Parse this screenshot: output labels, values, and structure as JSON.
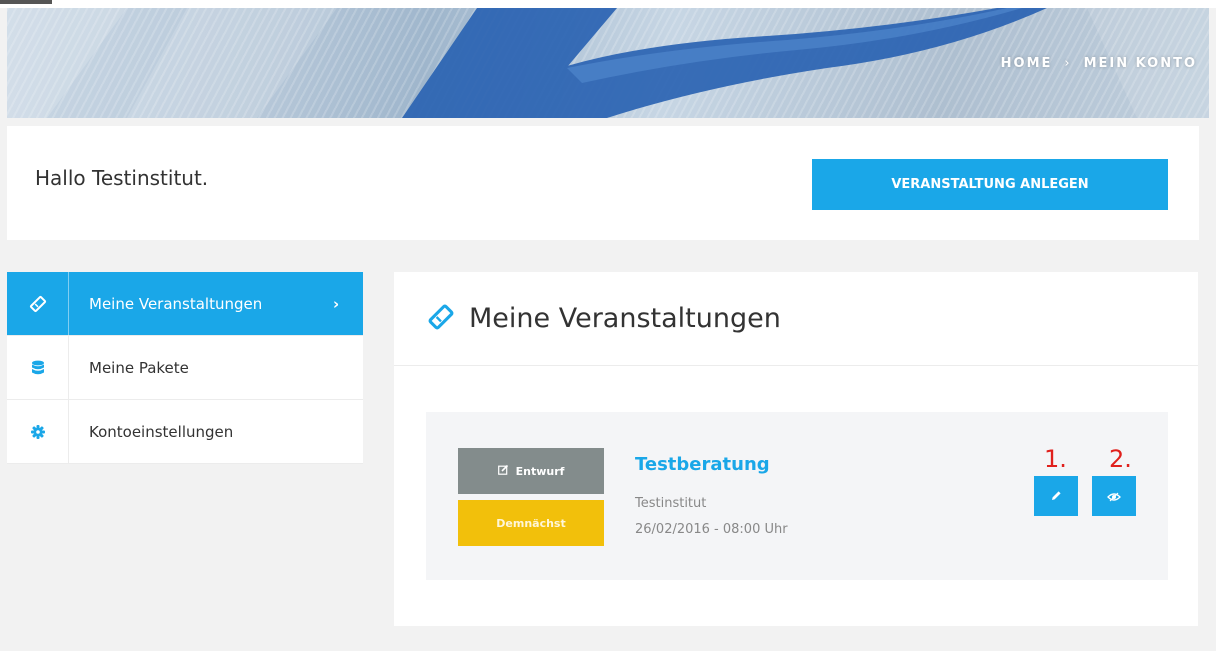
{
  "header": {
    "breadcrumb": {
      "home": "HOME",
      "separator": "›",
      "current": "MEIN KONTO"
    }
  },
  "greeting": {
    "text": "Hallo Testinstitut."
  },
  "actions": {
    "create_event_label": "VERANSTALTUNG ANLEGEN"
  },
  "sidebar": {
    "items": [
      {
        "label": "Meine Veranstaltungen",
        "icon": "ticket-icon",
        "active": true
      },
      {
        "label": "Meine Pakete",
        "icon": "database-icon",
        "active": false
      },
      {
        "label": "Kontoeinstellungen",
        "icon": "gear-icon",
        "active": false
      }
    ]
  },
  "main": {
    "title": "Meine Veranstaltungen",
    "events": [
      {
        "status_label": "Entwurf",
        "schedule_label": "Demnächst",
        "title": "Testberatung",
        "organizer": "Testinstitut",
        "datetime": "26/02/2016 - 08:00 Uhr",
        "action_numbers": [
          "1.",
          "2."
        ]
      }
    ]
  },
  "colors": {
    "accent": "#1aa7e8",
    "draft_badge": "#838c8c",
    "soon_badge": "#f2c00b",
    "annotation": "#e0201c"
  }
}
